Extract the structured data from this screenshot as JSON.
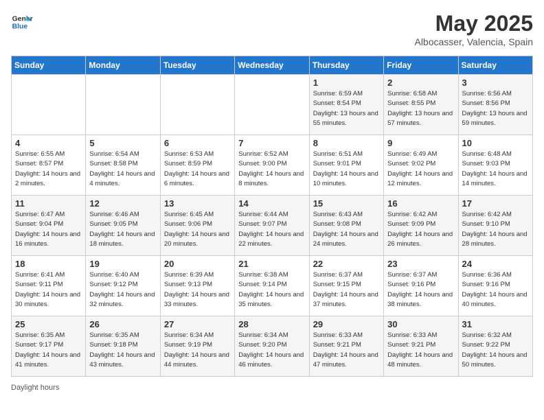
{
  "header": {
    "logo_line1": "General",
    "logo_line2": "Blue",
    "month": "May 2025",
    "location": "Albocasser, Valencia, Spain"
  },
  "weekdays": [
    "Sunday",
    "Monday",
    "Tuesday",
    "Wednesday",
    "Thursday",
    "Friday",
    "Saturday"
  ],
  "weeks": [
    [
      {
        "day": "",
        "sunrise": "",
        "sunset": "",
        "daylight": ""
      },
      {
        "day": "",
        "sunrise": "",
        "sunset": "",
        "daylight": ""
      },
      {
        "day": "",
        "sunrise": "",
        "sunset": "",
        "daylight": ""
      },
      {
        "day": "",
        "sunrise": "",
        "sunset": "",
        "daylight": ""
      },
      {
        "day": "1",
        "sunrise": "Sunrise: 6:59 AM",
        "sunset": "Sunset: 8:54 PM",
        "daylight": "Daylight: 13 hours and 55 minutes."
      },
      {
        "day": "2",
        "sunrise": "Sunrise: 6:58 AM",
        "sunset": "Sunset: 8:55 PM",
        "daylight": "Daylight: 13 hours and 57 minutes."
      },
      {
        "day": "3",
        "sunrise": "Sunrise: 6:56 AM",
        "sunset": "Sunset: 8:56 PM",
        "daylight": "Daylight: 13 hours and 59 minutes."
      }
    ],
    [
      {
        "day": "4",
        "sunrise": "Sunrise: 6:55 AM",
        "sunset": "Sunset: 8:57 PM",
        "daylight": "Daylight: 14 hours and 2 minutes."
      },
      {
        "day": "5",
        "sunrise": "Sunrise: 6:54 AM",
        "sunset": "Sunset: 8:58 PM",
        "daylight": "Daylight: 14 hours and 4 minutes."
      },
      {
        "day": "6",
        "sunrise": "Sunrise: 6:53 AM",
        "sunset": "Sunset: 8:59 PM",
        "daylight": "Daylight: 14 hours and 6 minutes."
      },
      {
        "day": "7",
        "sunrise": "Sunrise: 6:52 AM",
        "sunset": "Sunset: 9:00 PM",
        "daylight": "Daylight: 14 hours and 8 minutes."
      },
      {
        "day": "8",
        "sunrise": "Sunrise: 6:51 AM",
        "sunset": "Sunset: 9:01 PM",
        "daylight": "Daylight: 14 hours and 10 minutes."
      },
      {
        "day": "9",
        "sunrise": "Sunrise: 6:49 AM",
        "sunset": "Sunset: 9:02 PM",
        "daylight": "Daylight: 14 hours and 12 minutes."
      },
      {
        "day": "10",
        "sunrise": "Sunrise: 6:48 AM",
        "sunset": "Sunset: 9:03 PM",
        "daylight": "Daylight: 14 hours and 14 minutes."
      }
    ],
    [
      {
        "day": "11",
        "sunrise": "Sunrise: 6:47 AM",
        "sunset": "Sunset: 9:04 PM",
        "daylight": "Daylight: 14 hours and 16 minutes."
      },
      {
        "day": "12",
        "sunrise": "Sunrise: 6:46 AM",
        "sunset": "Sunset: 9:05 PM",
        "daylight": "Daylight: 14 hours and 18 minutes."
      },
      {
        "day": "13",
        "sunrise": "Sunrise: 6:45 AM",
        "sunset": "Sunset: 9:06 PM",
        "daylight": "Daylight: 14 hours and 20 minutes."
      },
      {
        "day": "14",
        "sunrise": "Sunrise: 6:44 AM",
        "sunset": "Sunset: 9:07 PM",
        "daylight": "Daylight: 14 hours and 22 minutes."
      },
      {
        "day": "15",
        "sunrise": "Sunrise: 6:43 AM",
        "sunset": "Sunset: 9:08 PM",
        "daylight": "Daylight: 14 hours and 24 minutes."
      },
      {
        "day": "16",
        "sunrise": "Sunrise: 6:42 AM",
        "sunset": "Sunset: 9:09 PM",
        "daylight": "Daylight: 14 hours and 26 minutes."
      },
      {
        "day": "17",
        "sunrise": "Sunrise: 6:42 AM",
        "sunset": "Sunset: 9:10 PM",
        "daylight": "Daylight: 14 hours and 28 minutes."
      }
    ],
    [
      {
        "day": "18",
        "sunrise": "Sunrise: 6:41 AM",
        "sunset": "Sunset: 9:11 PM",
        "daylight": "Daylight: 14 hours and 30 minutes."
      },
      {
        "day": "19",
        "sunrise": "Sunrise: 6:40 AM",
        "sunset": "Sunset: 9:12 PM",
        "daylight": "Daylight: 14 hours and 32 minutes."
      },
      {
        "day": "20",
        "sunrise": "Sunrise: 6:39 AM",
        "sunset": "Sunset: 9:13 PM",
        "daylight": "Daylight: 14 hours and 33 minutes."
      },
      {
        "day": "21",
        "sunrise": "Sunrise: 6:38 AM",
        "sunset": "Sunset: 9:14 PM",
        "daylight": "Daylight: 14 hours and 35 minutes."
      },
      {
        "day": "22",
        "sunrise": "Sunrise: 6:37 AM",
        "sunset": "Sunset: 9:15 PM",
        "daylight": "Daylight: 14 hours and 37 minutes."
      },
      {
        "day": "23",
        "sunrise": "Sunrise: 6:37 AM",
        "sunset": "Sunset: 9:16 PM",
        "daylight": "Daylight: 14 hours and 38 minutes."
      },
      {
        "day": "24",
        "sunrise": "Sunrise: 6:36 AM",
        "sunset": "Sunset: 9:16 PM",
        "daylight": "Daylight: 14 hours and 40 minutes."
      }
    ],
    [
      {
        "day": "25",
        "sunrise": "Sunrise: 6:35 AM",
        "sunset": "Sunset: 9:17 PM",
        "daylight": "Daylight: 14 hours and 41 minutes."
      },
      {
        "day": "26",
        "sunrise": "Sunrise: 6:35 AM",
        "sunset": "Sunset: 9:18 PM",
        "daylight": "Daylight: 14 hours and 43 minutes."
      },
      {
        "day": "27",
        "sunrise": "Sunrise: 6:34 AM",
        "sunset": "Sunset: 9:19 PM",
        "daylight": "Daylight: 14 hours and 44 minutes."
      },
      {
        "day": "28",
        "sunrise": "Sunrise: 6:34 AM",
        "sunset": "Sunset: 9:20 PM",
        "daylight": "Daylight: 14 hours and 46 minutes."
      },
      {
        "day": "29",
        "sunrise": "Sunrise: 6:33 AM",
        "sunset": "Sunset: 9:21 PM",
        "daylight": "Daylight: 14 hours and 47 minutes."
      },
      {
        "day": "30",
        "sunrise": "Sunrise: 6:33 AM",
        "sunset": "Sunset: 9:21 PM",
        "daylight": "Daylight: 14 hours and 48 minutes."
      },
      {
        "day": "31",
        "sunrise": "Sunrise: 6:32 AM",
        "sunset": "Sunset: 9:22 PM",
        "daylight": "Daylight: 14 hours and 50 minutes."
      }
    ]
  ],
  "footer": {
    "daylight_hours_label": "Daylight hours"
  }
}
